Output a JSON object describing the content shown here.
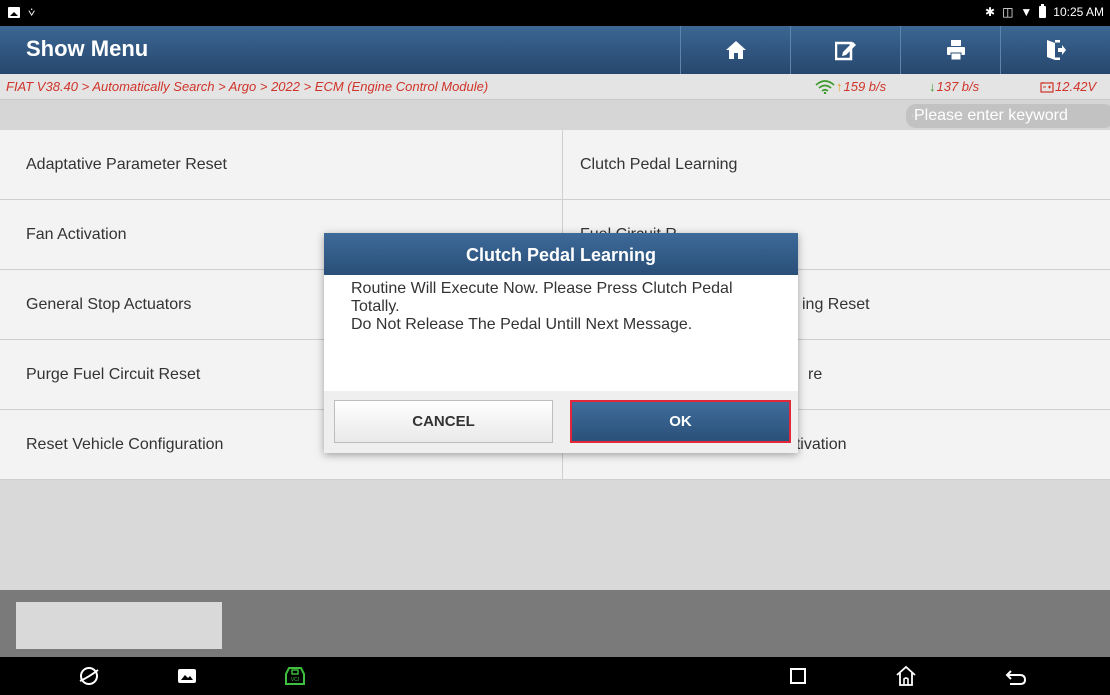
{
  "status_bar": {
    "time": "10:25 AM"
  },
  "header": {
    "title": "Show Menu",
    "buttons": [
      "home",
      "edit",
      "print",
      "exit"
    ]
  },
  "breadcrumb": {
    "path": "FIAT V38.40 > Automatically Search > Argo > 2022 > ECM (Engine Control Module)",
    "upload_rate": "159 b/s",
    "download_rate": "137 b/s",
    "voltage": "12.42V"
  },
  "search": {
    "placeholder": "Please enter keyword"
  },
  "menu": {
    "left": [
      "Adaptative Parameter Reset",
      "Fan Activation",
      "General Stop Actuators",
      "Purge Fuel Circuit Reset",
      "Reset Vehicle Configuration"
    ],
    "right": [
      "Clutch Pedal Learning",
      "Fuel Circuit R",
      "ing Reset",
      "re",
      "Self Learning Throttle Body Activation"
    ]
  },
  "dialog": {
    "title": "Clutch Pedal Learning",
    "message_line1": "Routine Will Execute Now. Please Press Clutch Pedal Totally.",
    "message_line2": "Do Not Release The Pedal Untill Next Message.",
    "cancel_label": "CANCEL",
    "ok_label": "OK",
    "accent_color": "#2b5079",
    "highlight_color": "#e0283a"
  },
  "icons": {
    "status_left": [
      "image-icon",
      "usb-debug-icon"
    ],
    "status_right": [
      "bluetooth-icon",
      "vibrate-icon",
      "wifi-signal-icon",
      "battery-icon"
    ],
    "nav": [
      "browser-icon",
      "gallery-icon",
      "vci-icon",
      "recents-icon",
      "home-icon",
      "back-icon"
    ]
  }
}
